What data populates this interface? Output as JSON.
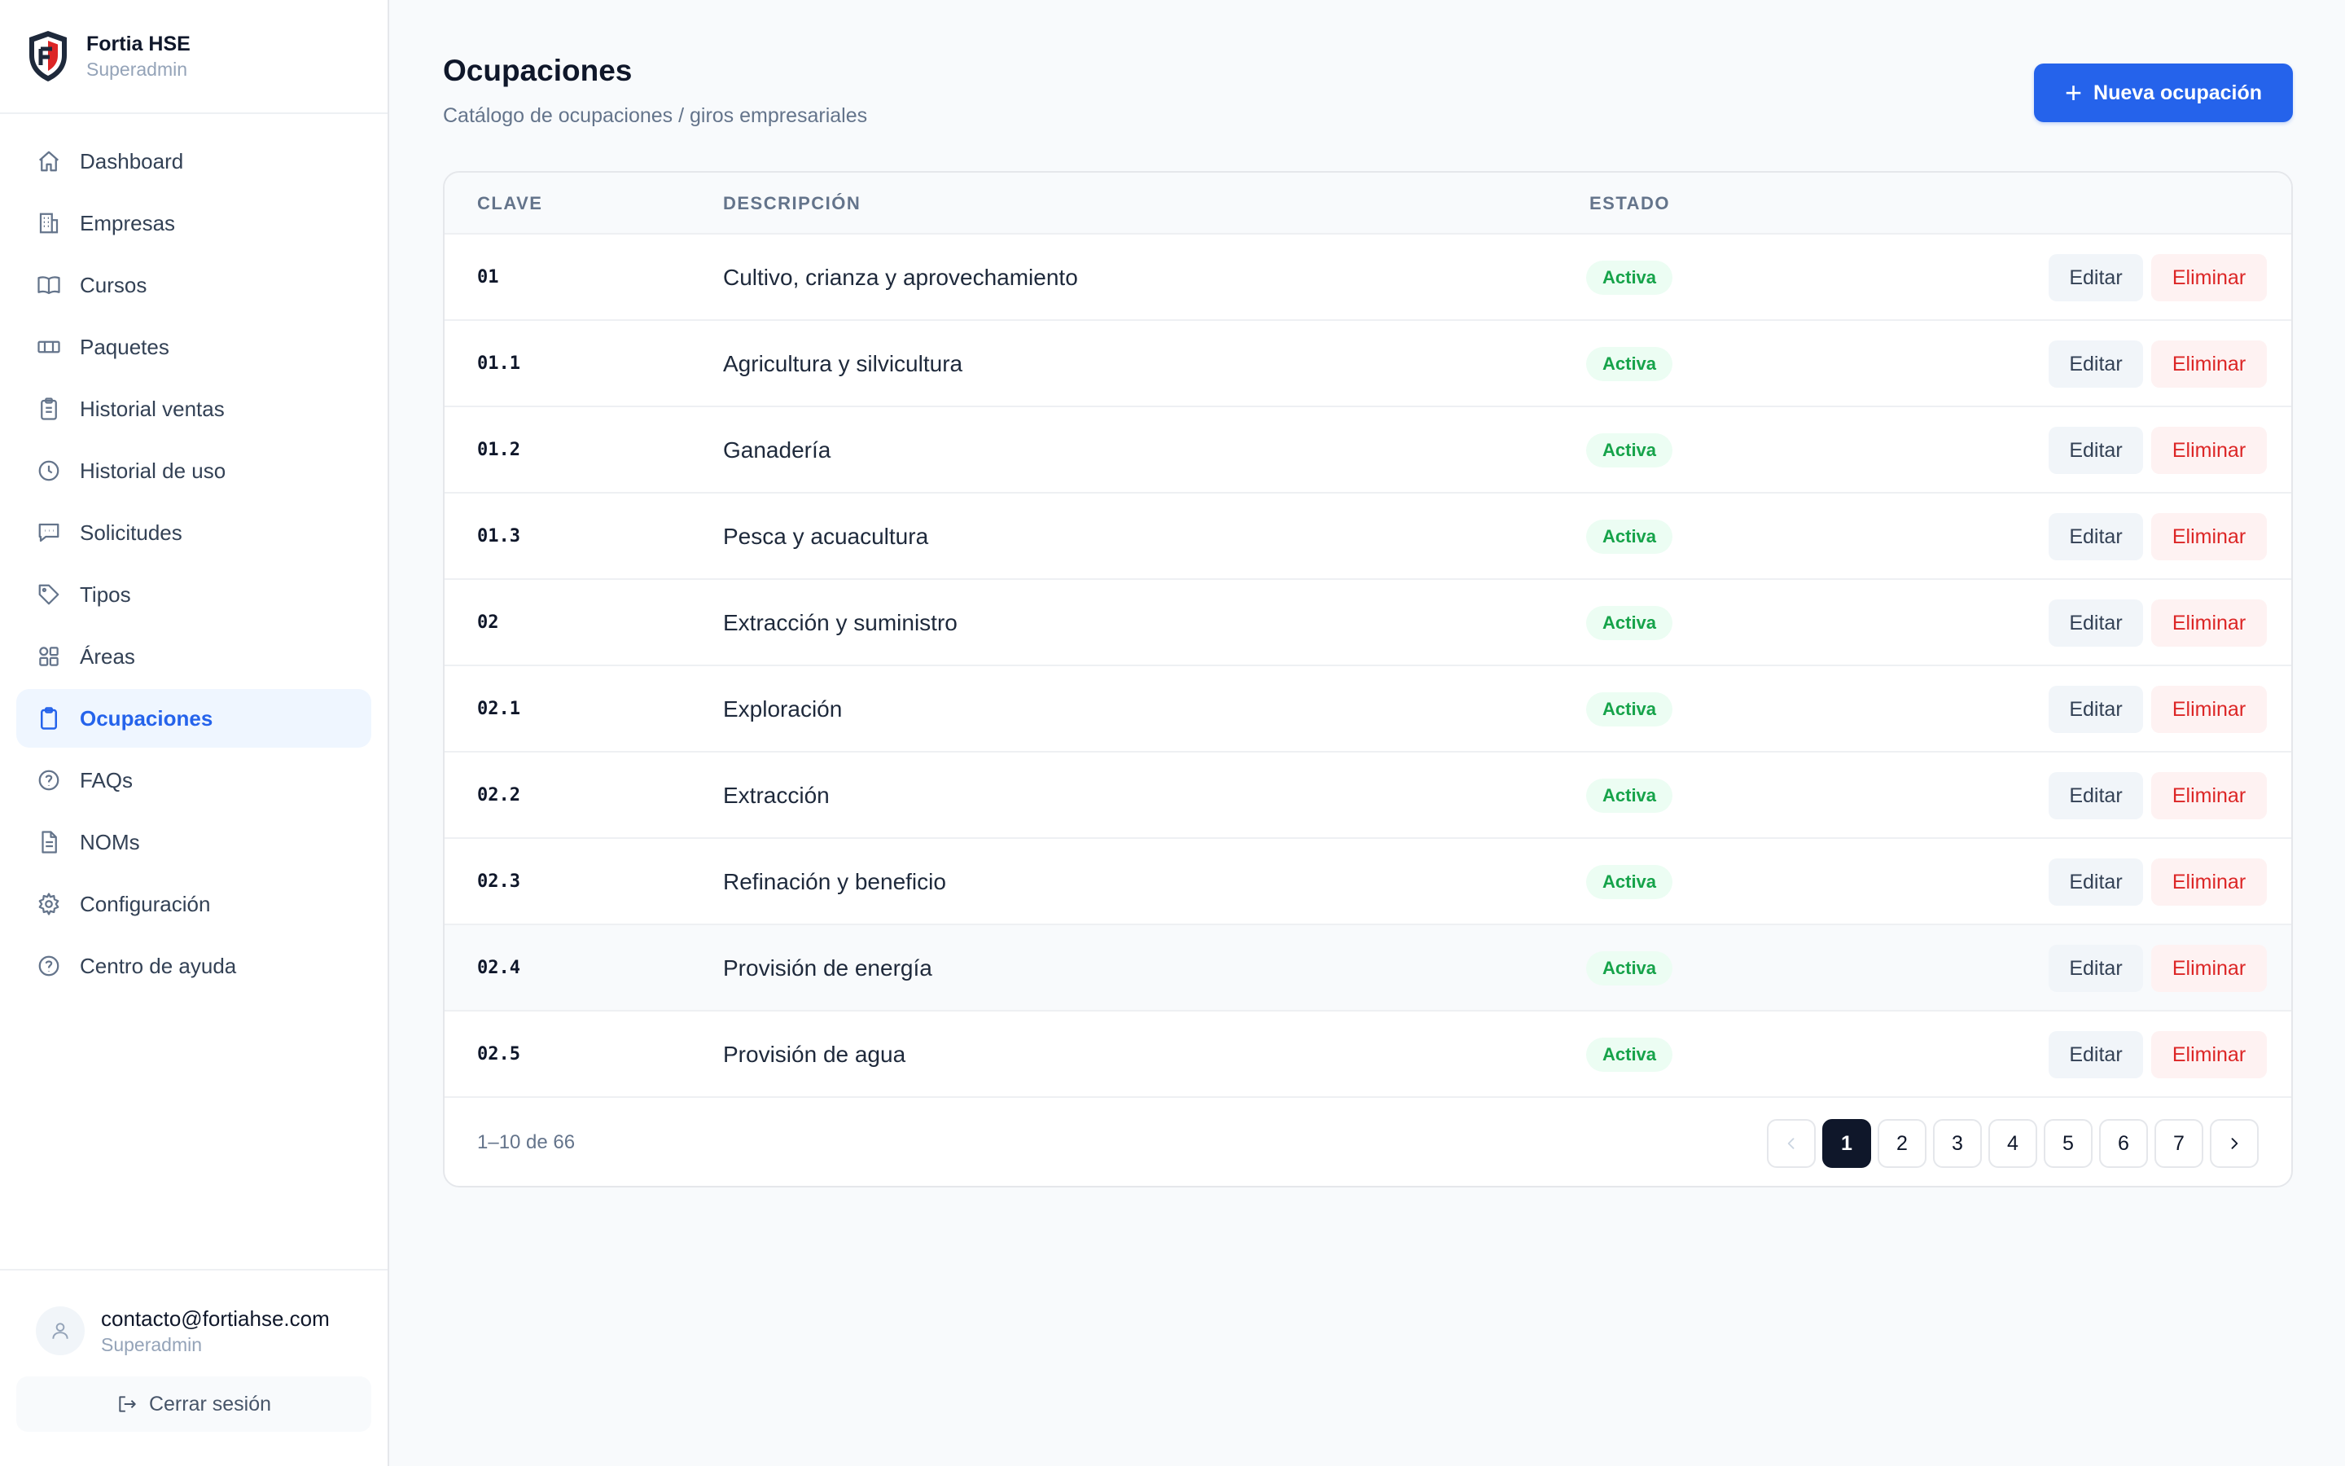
{
  "brand": {
    "name": "Fortia HSE",
    "role": "Superadmin"
  },
  "sidebar": {
    "items": [
      {
        "label": "Dashboard",
        "icon": "home-icon"
      },
      {
        "label": "Empresas",
        "icon": "building-icon"
      },
      {
        "label": "Cursos",
        "icon": "book-icon"
      },
      {
        "label": "Paquetes",
        "icon": "ticket-icon"
      },
      {
        "label": "Historial ventas",
        "icon": "clipboard-icon"
      },
      {
        "label": "Historial de uso",
        "icon": "clock-icon"
      },
      {
        "label": "Solicitudes",
        "icon": "message-icon"
      },
      {
        "label": "Tipos",
        "icon": "tag-icon"
      },
      {
        "label": "Áreas",
        "icon": "grid-icon"
      },
      {
        "label": "Ocupaciones",
        "icon": "clipboard-list-icon",
        "active": true
      },
      {
        "label": "FAQs",
        "icon": "help-circle-icon"
      },
      {
        "label": "NOMs",
        "icon": "file-text-icon"
      },
      {
        "label": "Configuración",
        "icon": "gear-icon"
      },
      {
        "label": "Centro de ayuda",
        "icon": "help-circle-icon"
      }
    ]
  },
  "user": {
    "email": "contacto@fortiahse.com",
    "role": "Superadmin",
    "logout_label": "Cerrar sesión"
  },
  "header": {
    "title": "Ocupaciones",
    "subtitle": "Catálogo de ocupaciones / giros empresariales",
    "new_button": "Nueva ocupación"
  },
  "table": {
    "columns": {
      "code": "CLAVE",
      "description": "DESCRIPCIÓN",
      "status": "ESTADO"
    },
    "edit_label": "Editar",
    "delete_label": "Eliminar",
    "rows": [
      {
        "code": "01",
        "description": "Cultivo, crianza y aprovechamiento",
        "status": "Activa"
      },
      {
        "code": "01.1",
        "description": "Agricultura y silvicultura",
        "status": "Activa"
      },
      {
        "code": "01.2",
        "description": "Ganadería",
        "status": "Activa"
      },
      {
        "code": "01.3",
        "description": "Pesca y acuacultura",
        "status": "Activa"
      },
      {
        "code": "02",
        "description": "Extracción y suministro",
        "status": "Activa"
      },
      {
        "code": "02.1",
        "description": "Exploración",
        "status": "Activa"
      },
      {
        "code": "02.2",
        "description": "Extracción",
        "status": "Activa"
      },
      {
        "code": "02.3",
        "description": "Refinación y beneficio",
        "status": "Activa"
      },
      {
        "code": "02.4",
        "description": "Provisión de energía",
        "status": "Activa"
      },
      {
        "code": "02.5",
        "description": "Provisión de agua",
        "status": "Activa"
      }
    ]
  },
  "pagination": {
    "range_label": "1–10 de 66",
    "pages": [
      "1",
      "2",
      "3",
      "4",
      "5",
      "6",
      "7"
    ],
    "current": "1"
  },
  "colors": {
    "accent": "#2563eb",
    "status_active_bg": "#ecfdf3",
    "status_active_text": "#16a34a",
    "danger": "#dc2626",
    "current_page": "#0f172a"
  }
}
